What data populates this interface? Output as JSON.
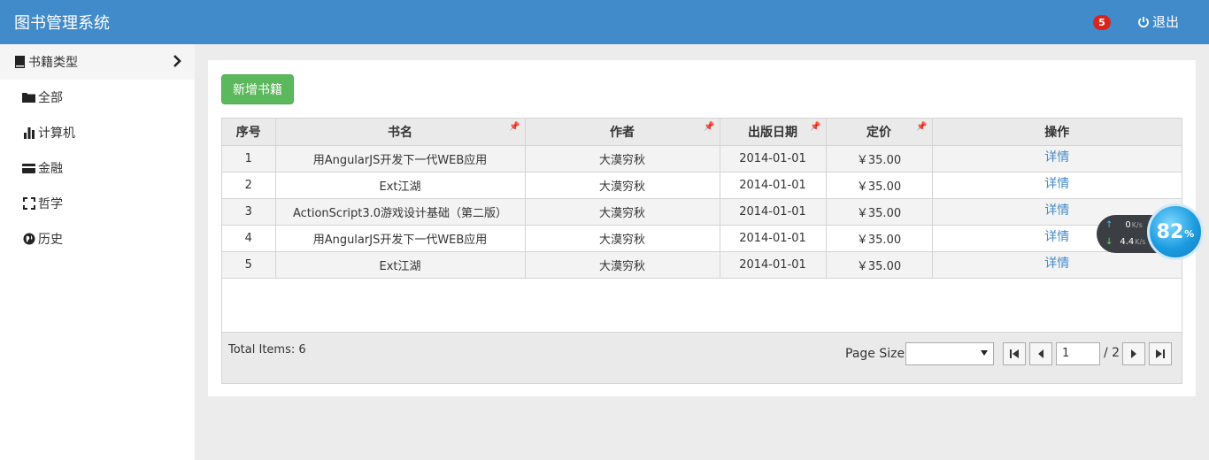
{
  "header": {
    "title": "图书管理系统",
    "badge_count": "5",
    "logout_label": "退出"
  },
  "sidebar": {
    "section_label": "书籍类型",
    "items": [
      {
        "label": "全部",
        "icon": "folder-icon"
      },
      {
        "label": "计算机",
        "icon": "bar-chart-icon"
      },
      {
        "label": "金融",
        "icon": "credit-card-icon"
      },
      {
        "label": "哲学",
        "icon": "fullscreen-icon"
      },
      {
        "label": "历史",
        "icon": "globe-icon"
      }
    ]
  },
  "toolbar": {
    "add_label": "新增书籍"
  },
  "table": {
    "columns": [
      "序号",
      "书名",
      "作者",
      "出版日期",
      "定价",
      "操作"
    ],
    "rows": [
      {
        "no": "1",
        "title": "用AngularJS开发下一代WEB应用",
        "author": "大漠穷秋",
        "date": "2014-01-01",
        "price": "￥35.00",
        "action": "详情"
      },
      {
        "no": "2",
        "title": "Ext江湖",
        "author": "大漠穷秋",
        "date": "2014-01-01",
        "price": "￥35.00",
        "action": "详情"
      },
      {
        "no": "3",
        "title": "ActionScript3.0游戏设计基础（第二版）",
        "author": "大漠穷秋",
        "date": "2014-01-01",
        "price": "￥35.00",
        "action": "详情"
      },
      {
        "no": "4",
        "title": "用AngularJS开发下一代WEB应用",
        "author": "大漠穷秋",
        "date": "2014-01-01",
        "price": "￥35.00",
        "action": "详情"
      },
      {
        "no": "5",
        "title": "Ext江湖",
        "author": "大漠穷秋",
        "date": "2014-01-01",
        "price": "￥35.00",
        "action": "详情"
      }
    ]
  },
  "pager": {
    "total_items": "Total Items: 6",
    "page_size_label": "Page Size:",
    "page_size_value": "",
    "current_page": "1",
    "total_pages": "/ 2"
  },
  "net_widget": {
    "upload": "0",
    "download": "4.4",
    "unit": "K/s",
    "percent": "82",
    "percent_sign": "%"
  },
  "colors": {
    "header_bg": "#428bca",
    "add_button": "#5cb85c",
    "link": "#428bca",
    "badge": "#d9261c"
  }
}
